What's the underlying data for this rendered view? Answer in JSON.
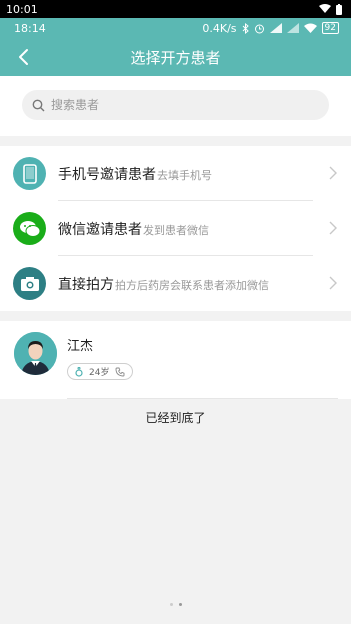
{
  "outer_status": {
    "time": "10:01"
  },
  "app_status": {
    "time": "18:14",
    "network_speed": "0.4K/s",
    "battery": "92"
  },
  "header": {
    "title": "选择开方患者"
  },
  "search": {
    "placeholder": "搜索患者",
    "value": ""
  },
  "invite_options": [
    {
      "label": "手机号邀请患者",
      "hint": "去填手机号",
      "icon": "phone-icon",
      "icon_color": "#4fb2b2"
    },
    {
      "label": "微信邀请患者",
      "hint": "发到患者微信",
      "icon": "wechat-icon",
      "icon_color": "#1aad19"
    },
    {
      "label": "直接拍方",
      "hint": "拍方后药房会联系患者添加微信",
      "icon": "camera-icon",
      "icon_color": "#2d7f84"
    }
  ],
  "patients": [
    {
      "name": "江杰",
      "age": "24岁",
      "gender_icon": "male-icon",
      "phone_icon": "phone-call-icon"
    }
  ],
  "list_end_text": "已经到底了",
  "colors": {
    "accent": "#5bb8b3",
    "background": "#f2f2f2"
  }
}
